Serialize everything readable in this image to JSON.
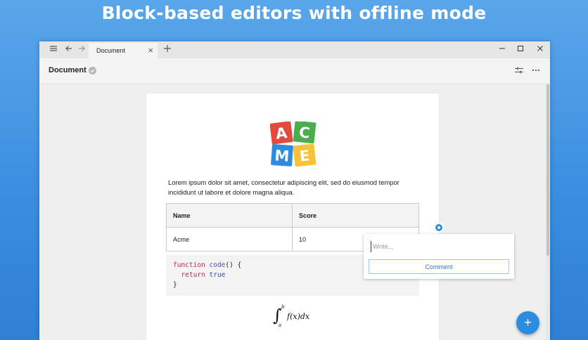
{
  "headline": "Block-based editors with offline mode",
  "tab": {
    "label": "Document"
  },
  "doc": {
    "title": "Document"
  },
  "logo": {
    "letters": [
      "A",
      "C",
      "M",
      "E"
    ],
    "colors": [
      "#e34a3d",
      "#4aae4f",
      "#2f8be0",
      "#f5c23a"
    ]
  },
  "paragraph": "Lorem ipsum dolor sit amet, consectetur adipiscing elit, sed do eiusmod tempor incididunt ut labore et dolore magna aliqua.",
  "table": {
    "headers": [
      "Name",
      "Score"
    ],
    "rows": [
      [
        "Acme",
        "10"
      ]
    ]
  },
  "code": {
    "line1_kw": "function",
    "line1_fn": "code",
    "line1_rest": "() {",
    "line2_kw": "return",
    "line2_val": "true",
    "line3": "}"
  },
  "math": {
    "upper": "b",
    "lower": "a",
    "body": "f(x)dx"
  },
  "comment": {
    "placeholder": "Write...",
    "button": "Comment"
  },
  "fab": {
    "label": "+"
  },
  "colors": {
    "accent": "#2c8ce0",
    "background": "#3b8ee0"
  }
}
